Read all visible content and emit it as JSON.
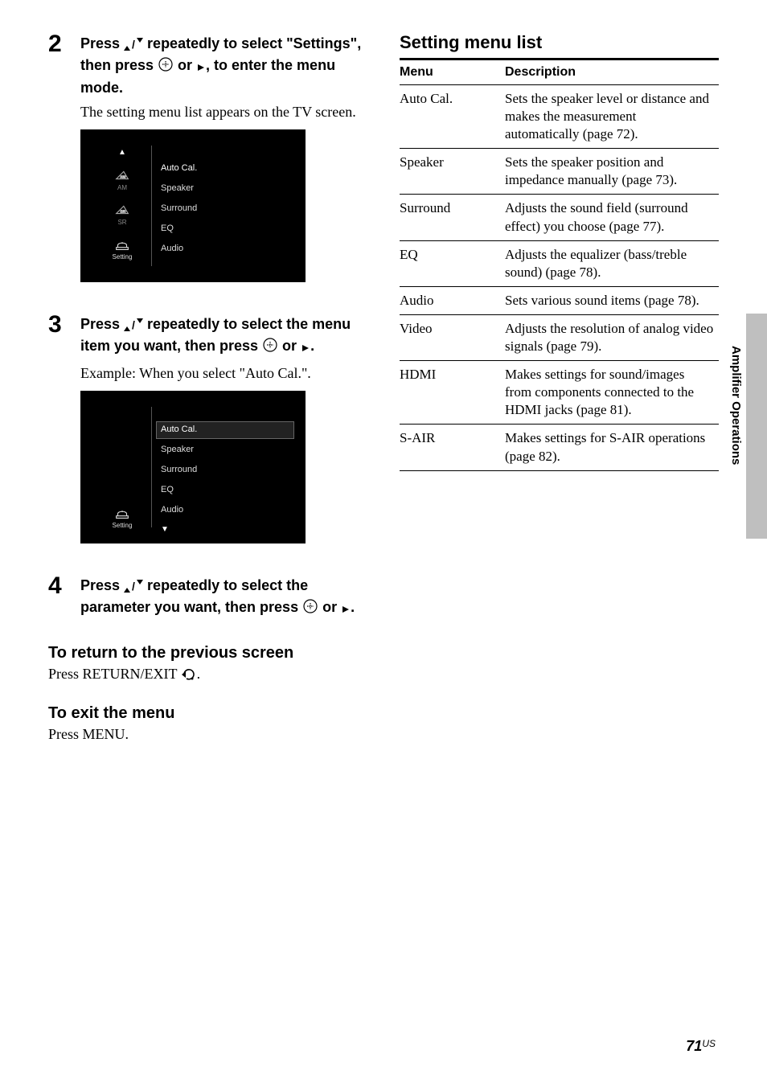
{
  "steps": {
    "s2": {
      "num": "2",
      "title_pre": "Press ",
      "title_mid1": " repeatedly to select \"Settings\", then press ",
      "title_mid2": " or ",
      "title_post": ", to enter the menu mode.",
      "text": "The setting menu list appears on the TV screen."
    },
    "s3": {
      "num": "3",
      "title_pre": "Press ",
      "title_mid1": " repeatedly to select the menu item you want, then press ",
      "title_mid2": " or ",
      "title_post": ".",
      "text": "Example: When you select \"Auto Cal.\"."
    },
    "s4": {
      "num": "4",
      "title_pre": "Press ",
      "title_mid1": " repeatedly to select the parameter you want, then press ",
      "title_mid2": " or ",
      "title_post": "."
    }
  },
  "tv1": {
    "icons": [
      {
        "badge": "AM",
        "label": "AM"
      },
      {
        "badge": "SR",
        "label": "SR"
      }
    ],
    "setting_label": "Setting",
    "items": [
      "Auto Cal.",
      "Speaker",
      "Surround",
      "EQ",
      "Audio"
    ]
  },
  "tv2": {
    "setting_label": "Setting",
    "items": [
      "Auto Cal.",
      "Speaker",
      "Surround",
      "EQ",
      "Audio"
    ]
  },
  "return_heading": "To return to the previous screen",
  "return_text_pre": "Press RETURN/EXIT ",
  "return_text_post": ".",
  "exit_heading": "To exit the menu",
  "exit_text": "Press MENU.",
  "right": {
    "title": "Setting menu list",
    "header_menu": "Menu",
    "header_desc": "Description",
    "rows": [
      {
        "menu": "Auto Cal.",
        "desc": "Sets the speaker level or distance and makes the measurement automatically (page 72)."
      },
      {
        "menu": "Speaker",
        "desc": "Sets the speaker position and impedance manually (page 73)."
      },
      {
        "menu": "Surround",
        "desc": "Adjusts the sound field (surround effect) you choose (page 77)."
      },
      {
        "menu": "EQ",
        "desc": "Adjusts the equalizer (bass/treble sound) (page 78)."
      },
      {
        "menu": "Audio",
        "desc": "Sets various sound items (page 78)."
      },
      {
        "menu": "Video",
        "desc": "Adjusts the resolution of analog video signals (page 79)."
      },
      {
        "menu": "HDMI",
        "desc": "Makes settings for sound/images from components connected to the HDMI jacks (page 81)."
      },
      {
        "menu": "S-AIR",
        "desc": "Makes settings for S-AIR operations (page 82)."
      }
    ]
  },
  "side_tab": "Amplifier Operations",
  "page_num": "71",
  "page_suffix": "US"
}
